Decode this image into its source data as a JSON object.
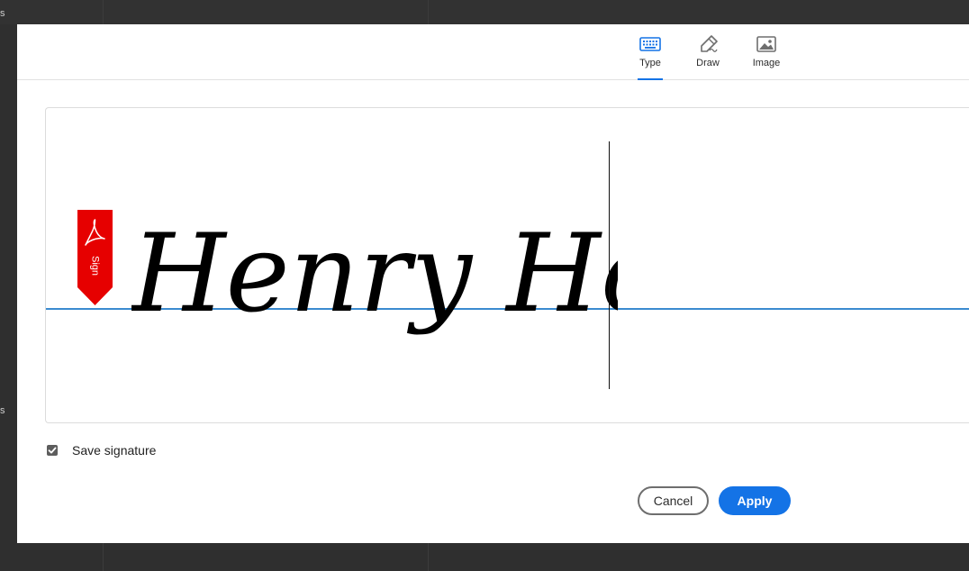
{
  "tabs": {
    "type": {
      "label": "Type",
      "icon": "keyboard-icon",
      "active": true
    },
    "draw": {
      "label": "Draw",
      "icon": "pen-icon",
      "active": false
    },
    "image": {
      "label": "Image",
      "icon": "image-icon",
      "active": false
    }
  },
  "signature": {
    "typed_text": "Henry Ho",
    "sign_flag_label": "Sign"
  },
  "save_signature": {
    "label": "Save signature",
    "checked": true
  },
  "buttons": {
    "cancel": "Cancel",
    "apply": "Apply"
  },
  "colors": {
    "accent": "#1473e6",
    "sign_flag": "#e60000",
    "baseline": "#3b8bd0"
  },
  "background_edge_text": [
    "s",
    "s"
  ]
}
